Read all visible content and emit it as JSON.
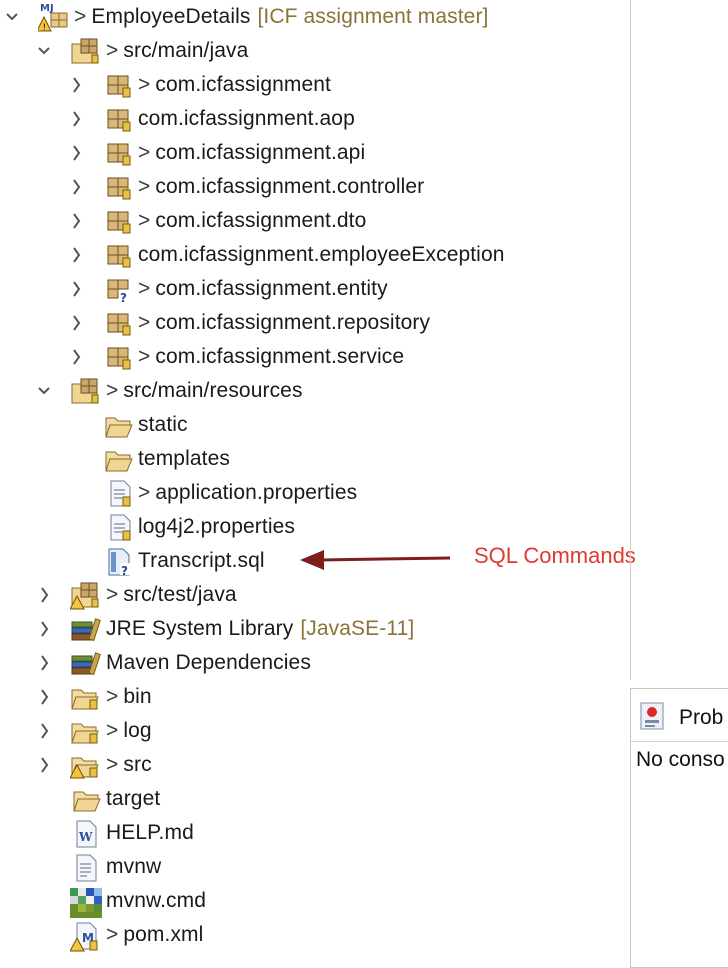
{
  "tree": {
    "project": {
      "name": "EmployeeDetails",
      "repo": "[ICF assignment master]",
      "badge": "M J"
    },
    "rows": [
      {
        "label": "src/main/java"
      },
      {
        "label": "com.icfassignment"
      },
      {
        "label": "com.icfassignment.aop"
      },
      {
        "label": "com.icfassignment.api"
      },
      {
        "label": "com.icfassignment.controller"
      },
      {
        "label": "com.icfassignment.dto"
      },
      {
        "label": "com.icfassignment.employeeException"
      },
      {
        "label": "com.icfassignment.entity"
      },
      {
        "label": "com.icfassignment.repository"
      },
      {
        "label": "com.icfassignment.service"
      },
      {
        "label": "src/main/resources"
      },
      {
        "label": "static"
      },
      {
        "label": "templates"
      },
      {
        "label": "application.properties"
      },
      {
        "label": "log4j2.properties"
      },
      {
        "label": "Transcript.sql"
      },
      {
        "label": "src/test/java"
      },
      {
        "label": "JRE System Library",
        "suffix": "[JavaSE-11]"
      },
      {
        "label": "Maven Dependencies"
      },
      {
        "label": "bin"
      },
      {
        "label": "log"
      },
      {
        "label": "src"
      },
      {
        "label": "target"
      },
      {
        "label": "HELP.md"
      },
      {
        "label": "mvnw"
      },
      {
        "label": "mvnw.cmd"
      },
      {
        "label": "pom.xml"
      }
    ],
    "modified_marker": ">"
  },
  "annotation": {
    "text": "SQL Commands",
    "color": "#dc3b33"
  },
  "console": {
    "tab_label": "Prob",
    "message": "No conso"
  },
  "colors": {
    "repo_text": "#8a7338",
    "annotation_arrow": "#7d1e1a"
  }
}
